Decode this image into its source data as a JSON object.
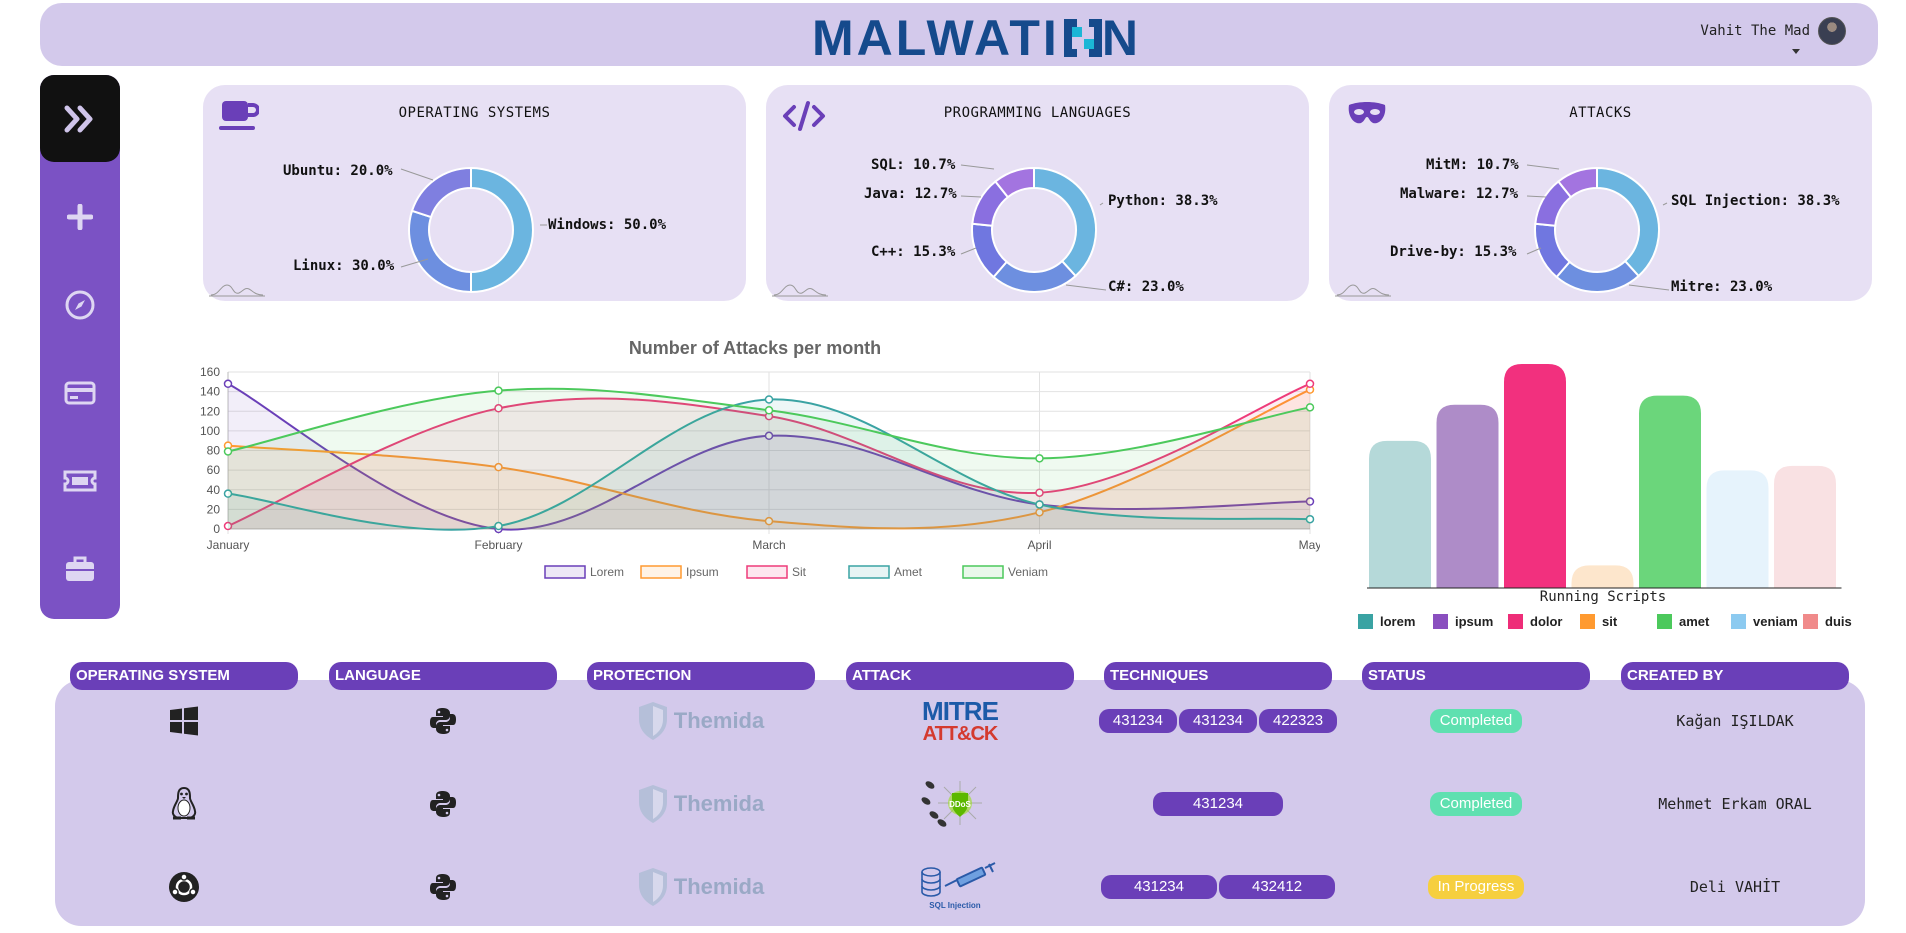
{
  "header": {
    "logo_text": "MALWATI",
    "user_name": "Vahit The Mad"
  },
  "sidebar": {
    "items": [
      {
        "icon": "double-chevron-right-icon"
      },
      {
        "icon": "plus-icon"
      },
      {
        "icon": "compass-icon"
      },
      {
        "icon": "credit-card-icon"
      },
      {
        "icon": "ticket-icon"
      },
      {
        "icon": "briefcase-icon"
      }
    ]
  },
  "cards": [
    {
      "title": "OPERATING SYSTEMS",
      "icon": "coffee-cup-icon",
      "labels": [
        "Ubuntu: 20.0%",
        "Windows: 50.0%",
        "Linux: 30.0%"
      ],
      "slices": [
        {
          "name": "Windows",
          "value": 50.0,
          "color": "#6bb5e0"
        },
        {
          "name": "Linux",
          "value": 30.0,
          "color": "#6d8fe0"
        },
        {
          "name": "Ubuntu",
          "value": 20.0,
          "color": "#7f7fe0"
        }
      ]
    },
    {
      "title": "PROGRAMMING LANGUAGES",
      "icon": "code-icon",
      "labels": [
        "SQL: 10.7%",
        "Java: 12.7%",
        "Python: 38.3%",
        "C++: 15.3%",
        "C#: 23.0%"
      ],
      "slices": [
        {
          "name": "Python",
          "value": 38.3,
          "color": "#6bb5e0"
        },
        {
          "name": "C#",
          "value": 23.0,
          "color": "#6d8fe0"
        },
        {
          "name": "C++",
          "value": 15.3,
          "color": "#7077e0"
        },
        {
          "name": "Java",
          "value": 12.7,
          "color": "#8a6fe0"
        },
        {
          "name": "SQL",
          "value": 10.7,
          "color": "#a374e0"
        }
      ]
    },
    {
      "title": "ATTACKS",
      "icon": "mask-icon",
      "labels": [
        "MitM: 10.7%",
        "Malware: 12.7%",
        "SQL Injection: 38.3%",
        "Drive-by: 15.3%",
        "Mitre: 23.0%"
      ],
      "slices": [
        {
          "name": "SQL Injection",
          "value": 38.3,
          "color": "#6bb5e0"
        },
        {
          "name": "Mitre",
          "value": 23.0,
          "color": "#6d8fe0"
        },
        {
          "name": "Drive-by",
          "value": 15.3,
          "color": "#7077e0"
        },
        {
          "name": "Malware",
          "value": 12.7,
          "color": "#8a6fe0"
        },
        {
          "name": "MitM",
          "value": 10.7,
          "color": "#a374e0"
        }
      ]
    }
  ],
  "chart_data": [
    {
      "type": "line",
      "title": "Number of Attacks per month",
      "categories": [
        "January",
        "February",
        "March",
        "April",
        "May"
      ],
      "ylim": [
        0,
        160
      ],
      "yticks": [
        0,
        20,
        40,
        60,
        80,
        100,
        120,
        140,
        160
      ],
      "grid": true,
      "legend": "bottom",
      "series": [
        {
          "name": "Lorem",
          "color": "#6a3fb8",
          "values": [
            148,
            0,
            95,
            25,
            28
          ]
        },
        {
          "name": "Ipsum",
          "color": "#ff9a30",
          "values": [
            85,
            63,
            8,
            17,
            142
          ]
        },
        {
          "name": "Sit",
          "color": "#ee3b7a",
          "values": [
            3,
            123,
            115,
            37,
            148
          ]
        },
        {
          "name": "Amet",
          "color": "#3aa3a3",
          "values": [
            36,
            3,
            132,
            25,
            10
          ]
        },
        {
          "name": "Veniam",
          "color": "#4cc95c",
          "values": [
            79,
            141,
            121,
            72,
            124
          ]
        }
      ]
    },
    {
      "type": "bar",
      "title": "Running Scripts",
      "categories": [
        "lorem",
        "ipsum",
        "dolor",
        "sit",
        "amet",
        "veniam",
        "duis"
      ],
      "values": [
        65,
        81,
        99,
        10,
        85,
        52,
        54
      ],
      "colors": [
        "#b5d9d9",
        "#ae8cc8",
        "#f2307e",
        "#fde6cc",
        "#6bd67b",
        "#e6f3fc",
        "#f9e1e3"
      ],
      "legend_colors": [
        "#3aa3a3",
        "#8a4fbf",
        "#ee2d78",
        "#ff9a30",
        "#4cc95c",
        "#8ccaf0",
        "#f08a8a"
      ],
      "legend": "bottom"
    }
  ],
  "table": {
    "headers": [
      "OPERATING SYSTEM",
      "LANGUAGE",
      "PROTECTION",
      "ATTACK",
      "TECHNIQUES",
      "STATUS",
      "CREATED BY"
    ],
    "rows": [
      {
        "os_icon": "windows-icon",
        "lang_icon": "python-icon",
        "protection": "Themida",
        "attack_type": "mitre",
        "attack_line1": "MITRE",
        "attack_line2": "ATT&CK",
        "techniques": [
          "431234",
          "431234",
          "422323"
        ],
        "status": "Completed",
        "status_color": "#5fe0b0",
        "created_by": "Kağan IŞILDAK"
      },
      {
        "os_icon": "linux-icon",
        "lang_icon": "python-icon",
        "protection": "Themida",
        "attack_type": "ddos",
        "attack_badge": "DDoS",
        "techniques": [
          "431234"
        ],
        "status": "Completed",
        "status_color": "#5fe0b0",
        "created_by": "Mehmet Erkam ORAL"
      },
      {
        "os_icon": "ubuntu-icon",
        "lang_icon": "python-icon",
        "protection": "Themida",
        "attack_type": "sqli",
        "attack_caption": "SQL Injection",
        "techniques": [
          "431234",
          "432412"
        ],
        "status": "In Progress",
        "status_color": "#f6cf3f",
        "created_by": "Deli VAHİT"
      }
    ]
  }
}
